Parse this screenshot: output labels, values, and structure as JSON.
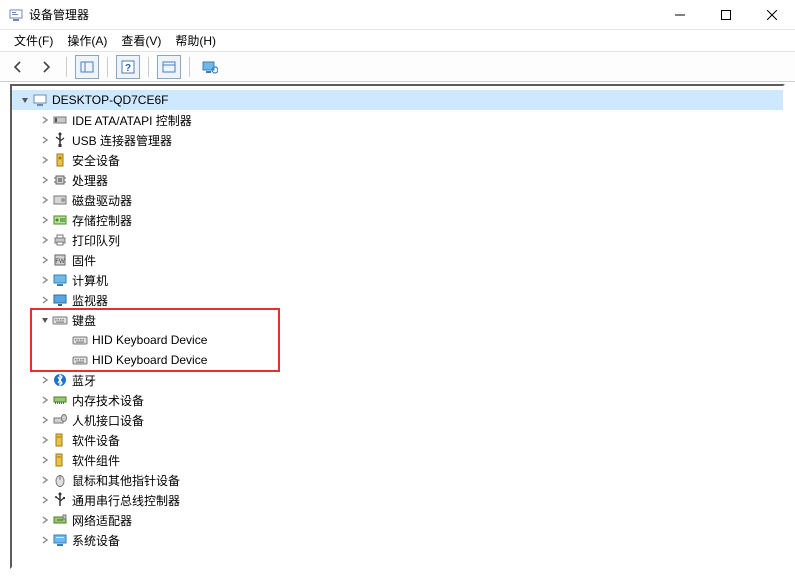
{
  "window": {
    "title": "设备管理器"
  },
  "menu": {
    "file": "文件(F)",
    "action": "操作(A)",
    "view": "查看(V)",
    "help": "帮助(H)"
  },
  "tree": {
    "root": "DESKTOP-QD7CE6F",
    "items": [
      {
        "label": "IDE ATA/ATAPI 控制器",
        "icon": "ide"
      },
      {
        "label": "USB 连接器管理器",
        "icon": "usb"
      },
      {
        "label": "安全设备",
        "icon": "security"
      },
      {
        "label": "处理器",
        "icon": "cpu"
      },
      {
        "label": "磁盘驱动器",
        "icon": "disk"
      },
      {
        "label": "存储控制器",
        "icon": "storage"
      },
      {
        "label": "打印队列",
        "icon": "printer"
      },
      {
        "label": "固件",
        "icon": "firmware"
      },
      {
        "label": "计算机",
        "icon": "computer"
      },
      {
        "label": "监视器",
        "icon": "monitor"
      },
      {
        "label": "键盘",
        "icon": "keyboard",
        "expanded": true,
        "children": [
          {
            "label": "HID Keyboard Device",
            "icon": "keyboard"
          },
          {
            "label": "HID Keyboard Device",
            "icon": "keyboard"
          }
        ]
      },
      {
        "label": "蓝牙",
        "icon": "bluetooth"
      },
      {
        "label": "内存技术设备",
        "icon": "memory"
      },
      {
        "label": "人机接口设备",
        "icon": "hid"
      },
      {
        "label": "软件设备",
        "icon": "software"
      },
      {
        "label": "软件组件",
        "icon": "software"
      },
      {
        "label": "鼠标和其他指针设备",
        "icon": "mouse"
      },
      {
        "label": "通用串行总线控制器",
        "icon": "usbctrl"
      },
      {
        "label": "网络适配器",
        "icon": "network"
      },
      {
        "label": "系统设备",
        "icon": "system"
      }
    ]
  },
  "highlight": {
    "start_index": 10,
    "row_count": 3
  }
}
